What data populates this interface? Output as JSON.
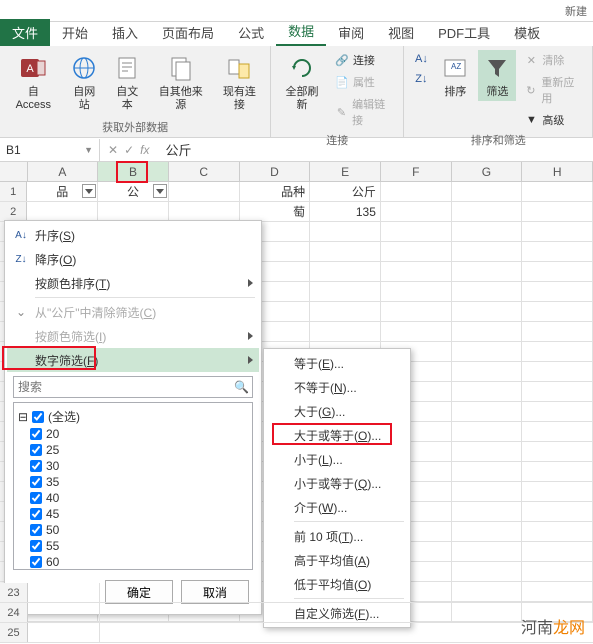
{
  "window": {
    "title": "新建"
  },
  "tabs": {
    "file": "文件",
    "items": [
      "开始",
      "插入",
      "页面布局",
      "公式",
      "数据",
      "审阅",
      "视图",
      "PDF工具",
      "模板"
    ],
    "active_index": 4
  },
  "ribbon": {
    "group1": {
      "label": "获取外部数据",
      "btns": [
        "自 Access",
        "自网站",
        "自文本",
        "自其他来源",
        "现有连接"
      ]
    },
    "group2": {
      "label": "连接",
      "refresh": "全部刷新",
      "items": [
        "连接",
        "属性",
        "编辑链接"
      ]
    },
    "group3": {
      "label": "排序和筛选",
      "asc": "升序",
      "desc": "降序",
      "sort": "排序",
      "filter": "筛选",
      "clear": "清除",
      "reapply": "重新应用",
      "advanced": "高级"
    }
  },
  "namebox": {
    "ref": "B1",
    "formula": "公斤"
  },
  "columns": [
    "A",
    "B",
    "C",
    "D",
    "E",
    "F",
    "G",
    "H"
  ],
  "rows_visible": [
    "1",
    "2"
  ],
  "rows_bottom": [
    "23",
    "24",
    "25"
  ],
  "cells": {
    "A1": "品",
    "B1": "公",
    "D1": "品种",
    "E1": "公斤",
    "D2": "萄",
    "E2": "135"
  },
  "filter_menu": {
    "sort_asc": "升序(S)",
    "sort_desc": "降序(O)",
    "sort_color": "按颜色排序(T)",
    "clear_filter": "从\"公斤\"中清除筛选(C)",
    "filter_color": "按颜色筛选(I)",
    "number_filter": "数字筛选(F)",
    "search_placeholder": "搜索",
    "select_all": "(全选)",
    "values": [
      "20",
      "25",
      "30",
      "35",
      "40",
      "45",
      "50",
      "55",
      "60"
    ],
    "ok": "确定",
    "cancel": "取消"
  },
  "number_submenu": {
    "equals": "等于(E)...",
    "not_equals": "不等于(N)...",
    "greater": "大于(G)...",
    "greater_eq": "大于或等于(O)...",
    "less": "小于(L)...",
    "less_eq": "小于或等于(Q)...",
    "between": "介于(W)...",
    "top10": "前 10 项(T)...",
    "above_avg": "高于平均值(A)",
    "below_avg": "低于平均值(O)",
    "custom": "自定义筛选(F)..."
  },
  "watermark": {
    "a": "河南",
    "b": "龙网"
  }
}
